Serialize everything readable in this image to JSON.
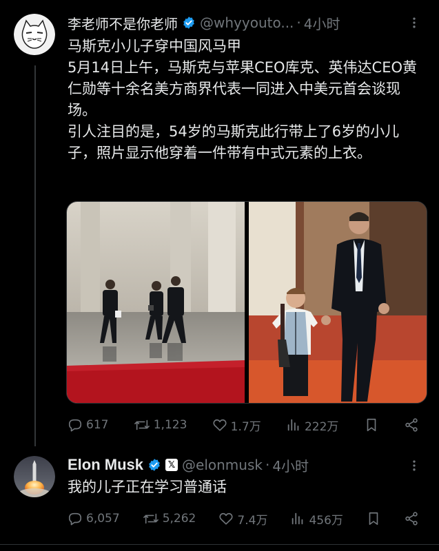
{
  "tweet1": {
    "display_name": "李老师不是你老师",
    "handle": "@whyyouto...",
    "dot": "·",
    "time": "4小时",
    "text_lines": [
      "马斯克小儿子穿中国风马甲",
      "5月14日上午，马斯克与苹果CEO库克、英伟达CEO黄仁勋等十余名美方商界代表一同进入中美元首会谈现场。",
      "引人注目的是，54岁的马斯克此行带上了6岁的小儿子，照片显示他穿着一件带有中式元素的上衣。"
    ],
    "replies": "617",
    "reposts": "1,123",
    "likes": "1.7万",
    "views": "222万"
  },
  "tweet2": {
    "display_name": "Elon Musk",
    "affiliate_badge": "𝕏",
    "handle": "@elonmusk",
    "dot": "·",
    "time": "4小时",
    "text": "我的儿子正在学习普通话",
    "replies": "6,057",
    "reposts": "5,262",
    "likes": "7.4万",
    "views": "456万"
  },
  "colors": {
    "background": "#000000",
    "text": "#e7e9ea",
    "secondary": "#71767b",
    "verified": "#1d9bf0",
    "border": "#2f3336"
  },
  "icons": {
    "verified": "verified-badge-icon",
    "more": "more-dots-icon",
    "reply": "reply-bubble-icon",
    "repost": "repost-arrows-icon",
    "like": "heart-icon",
    "views": "bar-chart-icon",
    "bookmark": "bookmark-icon",
    "share": "share-icon"
  }
}
